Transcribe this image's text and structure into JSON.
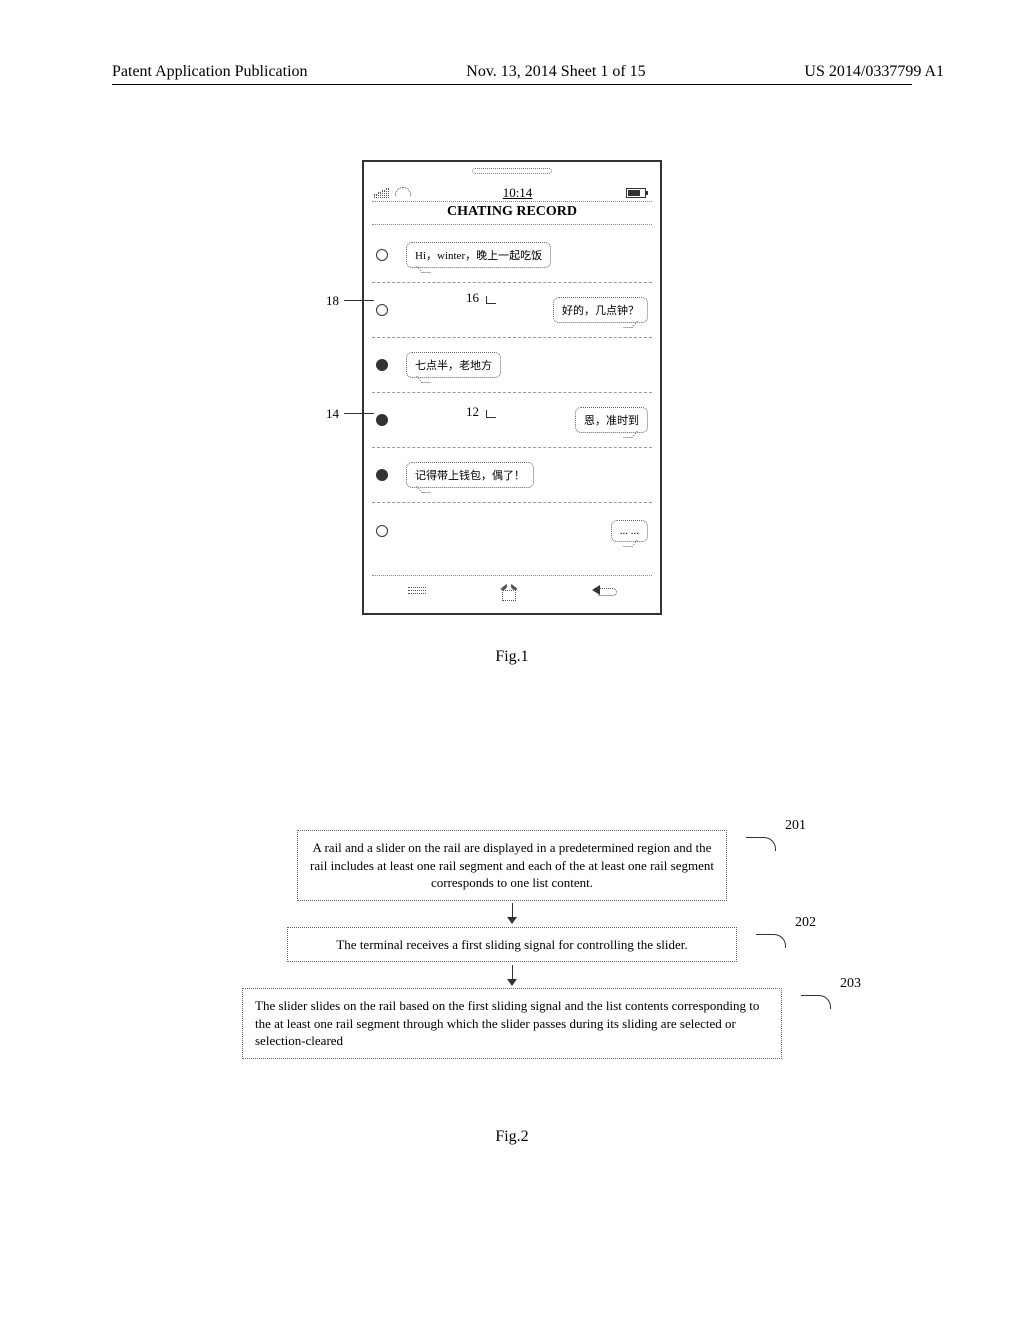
{
  "header": {
    "left": "Patent Application Publication",
    "center": "Nov. 13, 2014  Sheet 1 of 15",
    "right": "US 2014/0337799 A1"
  },
  "phone": {
    "status_time": "10:14",
    "title": "CHATING RECORD",
    "messages": [
      {
        "text": "Hi，winter，晚上一起吃饭",
        "side": "left",
        "selected": false
      },
      {
        "text": "好的，几点钟？",
        "side": "right",
        "selected": false
      },
      {
        "text": "七点半，老地方",
        "side": "left",
        "selected": true
      },
      {
        "text": "恩，准时到",
        "side": "right",
        "selected": true
      },
      {
        "text": "记得带上钱包，偶了！",
        "side": "left",
        "selected": true
      },
      {
        "text": "... ...",
        "side": "right",
        "selected": false
      }
    ],
    "callouts": {
      "ref18": "18",
      "ref14": "14",
      "ref16": "16",
      "ref12": "12"
    }
  },
  "figure_labels": {
    "fig1": "Fig.1",
    "fig2": "Fig.2"
  },
  "flow": {
    "steps": [
      {
        "num": "201",
        "text": "A rail and a slider on the rail are displayed in a predetermined region and the rail includes at least one rail segment and each of the at least one rail segment corresponds to one list content."
      },
      {
        "num": "202",
        "text": "The terminal receives a first sliding signal for controlling the slider."
      },
      {
        "num": "203",
        "text": "The slider slides on the rail based on the first sliding signal and the list contents corresponding to the at least one rail segment through which the slider passes during its sliding are selected or selection-cleared"
      }
    ]
  }
}
